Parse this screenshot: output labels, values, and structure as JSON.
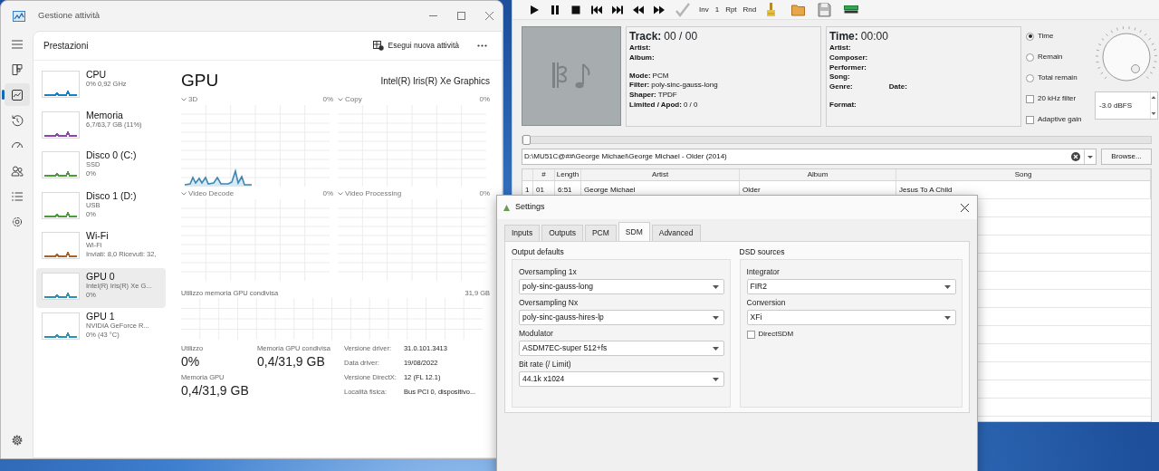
{
  "task_manager": {
    "title": "Gestione attività",
    "nav": [
      {
        "kind": "menu",
        "selected": false
      },
      {
        "kind": "processes",
        "selected": false
      },
      {
        "kind": "performance",
        "selected": true
      },
      {
        "kind": "history",
        "selected": false
      },
      {
        "kind": "startup",
        "selected": false
      },
      {
        "kind": "users",
        "selected": false
      },
      {
        "kind": "details",
        "selected": false
      },
      {
        "kind": "services",
        "selected": false
      },
      {
        "kind": "settings",
        "selected": false
      }
    ],
    "header": {
      "title": "Prestazioni",
      "action": "Esegui nuova attività"
    },
    "resources": [
      {
        "name": "CPU",
        "lines": [
          "0% 0,92 GHz"
        ],
        "color": "#1a7fc1",
        "selected": false
      },
      {
        "name": "Memoria",
        "lines": [
          "6,7/63,7 GB (11%)"
        ],
        "color": "#8e44ad",
        "selected": false
      },
      {
        "name": "Disco 0 (C:)",
        "lines": [
          "SSD",
          "0%"
        ],
        "color": "#4d9a3a",
        "selected": false
      },
      {
        "name": "Disco 1 (D:)",
        "lines": [
          "USB",
          "0%"
        ],
        "color": "#4d9a3a",
        "selected": false
      },
      {
        "name": "Wi-Fi",
        "lines": [
          "Wi-Fi",
          "Inviati: 8,0 Ricevuti: 32,"
        ],
        "color": "#a7622a",
        "selected": false
      },
      {
        "name": "GPU 0",
        "lines": [
          "Intel(R) Iris(R) Xe G...",
          "0%"
        ],
        "color": "#2b8fb8",
        "selected": true
      },
      {
        "name": "GPU 1",
        "lines": [
          "NVIDIA GeForce R...",
          "0% (43 °C)"
        ],
        "color": "#2b8fb8",
        "selected": false
      }
    ],
    "gpu": {
      "title": "GPU",
      "device": "Intel(R) Iris(R) Xe Graphics",
      "engines": [
        {
          "name": "3D",
          "value": "0%",
          "active": true
        },
        {
          "name": "Copy",
          "value": "0%",
          "active": false
        },
        {
          "name": "Video Decode",
          "value": "0%",
          "active": false
        },
        {
          "name": "Video Processing",
          "value": "0%",
          "active": false
        }
      ],
      "shared_memory": {
        "label": "Utilizzo memoria GPU condivisa",
        "max": "31,9 GB"
      },
      "stat_columns": [
        [
          {
            "label": "Utilizzo",
            "value": "0%"
          },
          {
            "label": "Memoria GPU",
            "value": "0,4/31,9 GB"
          }
        ],
        [
          {
            "label": "Memoria GPU condivisa",
            "value": "0,4/31,9 GB"
          }
        ]
      ],
      "details": [
        {
          "label": "Versione driver:",
          "value": "31.0.101.3413"
        },
        {
          "label": "Data driver:",
          "value": "19/08/2022"
        },
        {
          "label": "Versione DirectX:",
          "value": "12 (FL 12.1)"
        },
        {
          "label": "Località fisica:",
          "value": "Bus PCI 0, dispositivo..."
        }
      ]
    }
  },
  "player": {
    "toolbar": [
      {
        "kind": "play"
      },
      {
        "kind": "pause"
      },
      {
        "kind": "stop"
      },
      {
        "kind": "previous"
      },
      {
        "kind": "next"
      },
      {
        "kind": "rewind"
      },
      {
        "kind": "forward"
      },
      {
        "kind": "check"
      },
      {
        "kind": "text",
        "label": "Inv"
      },
      {
        "kind": "text",
        "label": "1"
      },
      {
        "kind": "text",
        "label": "Rpt"
      },
      {
        "kind": "text",
        "label": "Rnd"
      },
      {
        "kind": "brush"
      },
      {
        "kind": "folder"
      },
      {
        "kind": "save"
      },
      {
        "kind": "meter"
      }
    ],
    "track_panel": {
      "label": "Track:",
      "value": "00 / 00",
      "groups": [
        [
          [
            {
              "label": "Artist:"
            }
          ],
          [
            {
              "label": "Album:"
            }
          ]
        ],
        [
          [
            {
              "label": "Mode:",
              "value": "PCM"
            }
          ],
          [
            {
              "label": "Filter:",
              "value": "poly-sinc-gauss-long"
            }
          ],
          [
            {
              "label": "Shaper:",
              "value": "TPDF"
            }
          ],
          [
            {
              "label": "Limited / Apod:",
              "value": "0 / 0"
            }
          ]
        ]
      ]
    },
    "time_panel": {
      "label": "Time:",
      "value": "00:00",
      "groups": [
        [
          [
            {
              "label": "Artist:"
            }
          ],
          [
            {
              "label": "Composer:"
            }
          ],
          [
            {
              "label": "Performer:"
            }
          ],
          [
            {
              "label": "Song:"
            }
          ],
          [
            {
              "label": "Genre:"
            },
            {
              "label": "Date:"
            }
          ]
        ],
        [
          [
            {
              "label": "Format:"
            }
          ]
        ]
      ]
    },
    "radios": [
      {
        "label": "Time",
        "selected": true
      },
      {
        "label": "Remain",
        "selected": false
      },
      {
        "label": "Total remain",
        "selected": false
      }
    ],
    "checkboxes": [
      {
        "label": "20 kHz filter",
        "checked": false
      },
      {
        "label": "Adaptive gain",
        "checked": false
      }
    ],
    "gain": "-3.0 dBFS",
    "seek": {
      "level": 0
    },
    "path": "D:\\MU51C@##\\George Michael\\George Michael - Older (2014)",
    "browse": "Browse...",
    "columns": [
      "#",
      "Length",
      "Artist",
      "Album",
      "Song"
    ],
    "rows": [
      {
        "number": "1",
        "cells": [
          "01",
          "6:51",
          "George Michael",
          "Older",
          "Jesus To A Child"
        ]
      }
    ]
  },
  "settings": {
    "title": "Settings",
    "tabs": [
      {
        "label": "Inputs",
        "selected": false
      },
      {
        "label": "Outputs",
        "selected": false
      },
      {
        "label": "PCM",
        "selected": false
      },
      {
        "label": "SDM",
        "selected": true
      },
      {
        "label": "Advanced",
        "selected": false
      }
    ],
    "groups": [
      {
        "title": "Output defaults",
        "fields": [
          {
            "kind": "select",
            "label": "Oversampling 1x",
            "value": "poly-sinc-gauss-long"
          },
          {
            "kind": "select",
            "label": "Oversampling Nx",
            "value": "poly-sinc-gauss-hires-lp"
          },
          {
            "kind": "select",
            "label": "Modulator",
            "value": "ASDM7EC-super 512+fs"
          },
          {
            "kind": "select",
            "label": "Bit rate (/ Limit)",
            "value": "44.1k x1024"
          }
        ]
      },
      {
        "title": "DSD sources",
        "fields": [
          {
            "kind": "select",
            "label": "Integrator",
            "value": "FIR2"
          },
          {
            "kind": "select",
            "label": "Conversion",
            "value": "XFi"
          },
          {
            "kind": "checkbox",
            "label": "DirectSDM",
            "checked": false
          }
        ]
      }
    ]
  }
}
